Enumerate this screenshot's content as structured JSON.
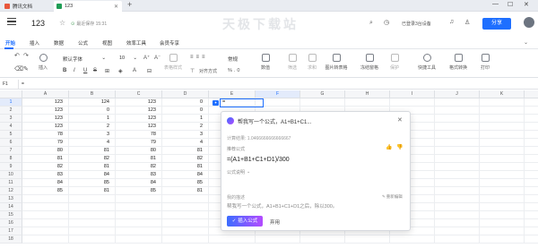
{
  "tabs": [
    {
      "label": "腾讯文档",
      "color": "#e8573b"
    },
    {
      "label": "123",
      "color": "#1f9d55"
    }
  ],
  "title": {
    "doc_name": "123",
    "save_status": "最近保存 15:31",
    "login_status": "已登录3台设备",
    "share_label": "分享"
  },
  "watermark": "天极下载站",
  "menu": [
    "开始",
    "插入",
    "数据",
    "公式",
    "视图",
    "效率工具",
    "会员专享"
  ],
  "toolbar": {
    "insert": "插入",
    "font_name": "默认字体",
    "font_size": "10",
    "table_style": "表格样式",
    "align": "对齐方式",
    "number_format": "常规",
    "number": "数值",
    "filter": "筛选",
    "sum": "求和",
    "image_to_table": "图片转表格",
    "freeze": "冻结窗格",
    "protect": "保护",
    "quick_tools": "快捷工具",
    "format_convert": "格式转换",
    "print": "打印"
  },
  "formula_bar": {
    "cell_ref": "F1",
    "content": "="
  },
  "columns": [
    "A",
    "B",
    "C",
    "D",
    "E",
    "F",
    "G",
    "H",
    "I",
    "J",
    "K",
    "L"
  ],
  "rows": [
    [
      "123",
      "124",
      "123",
      "0"
    ],
    [
      "123",
      "0",
      "123",
      "0"
    ],
    [
      "123",
      "1",
      "123",
      "1"
    ],
    [
      "123",
      "2",
      "123",
      "2"
    ],
    [
      "78",
      "3",
      "78",
      "3"
    ],
    [
      "79",
      "4",
      "79",
      "4"
    ],
    [
      "80",
      "81",
      "80",
      "81"
    ],
    [
      "81",
      "82",
      "81",
      "82"
    ],
    [
      "82",
      "81",
      "82",
      "81"
    ],
    [
      "83",
      "84",
      "83",
      "84"
    ],
    [
      "84",
      "85",
      "84",
      "85"
    ],
    [
      "85",
      "81",
      "85",
      "81"
    ]
  ],
  "row_count": 18,
  "active_cell_value": "=",
  "ai_popup": {
    "prompt": "帮我写一个公式，A1+B1+C1...",
    "result": "计算结果: 1.0466666666666667",
    "recommend_label": "推荐公式",
    "formula": "=(A1+B1+C1+D1)/300",
    "explain_label": "公式说明",
    "my_input_label": "我的描述",
    "edit_label": "重新编辑",
    "my_input": "帮我写一个公式，A1+B1+C1+D1之后，除以300。",
    "insert_button": "插入公式",
    "discard_button": "弃用"
  }
}
